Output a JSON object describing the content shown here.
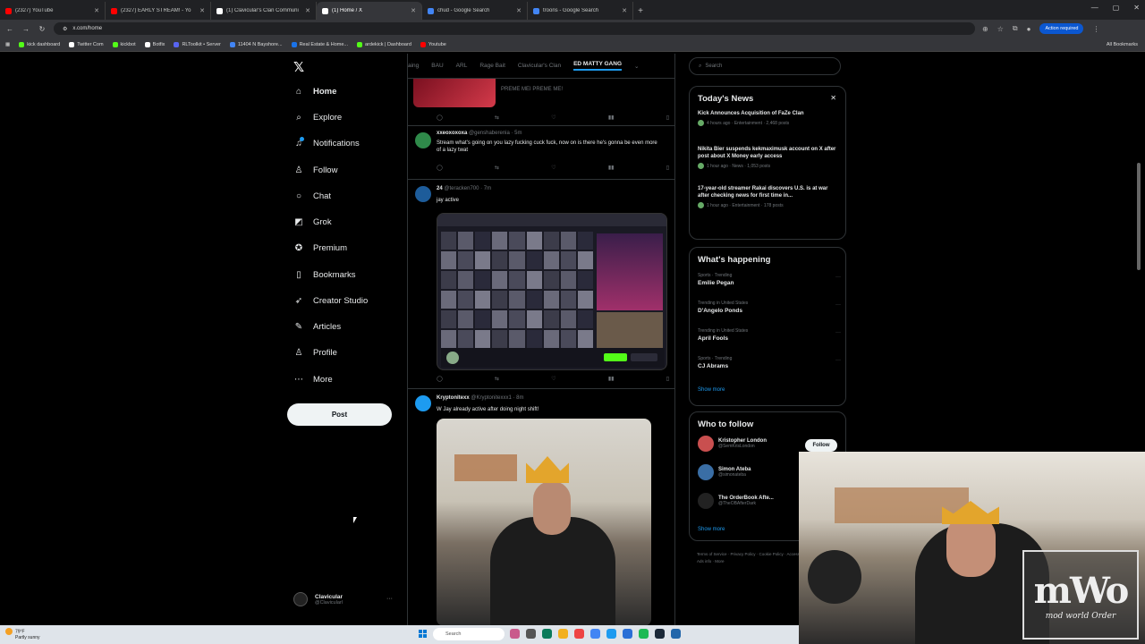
{
  "browser": {
    "tabs": [
      {
        "title": "(2327) YouTube",
        "color": "#ff0000",
        "active": false
      },
      {
        "title": "(2327) EARLY STREAM! - Yo",
        "color": "#ff0000",
        "active": false
      },
      {
        "title": "(1) Clavicular's Clan Communi",
        "color": "#ffffff",
        "active": false
      },
      {
        "title": "(1) Home / X",
        "color": "#ffffff",
        "active": true
      },
      {
        "title": "chud - Google Search",
        "color": "#4285f4",
        "active": false
      },
      {
        "title": "troons - Google Search",
        "color": "#4285f4",
        "active": false
      }
    ],
    "url": "x.com/home",
    "action_required": "Action required",
    "bookmarks": [
      {
        "label": "kick dashboard",
        "color": "#53fc18"
      },
      {
        "label": "Twitter Com",
        "color": "#ffffff"
      },
      {
        "label": "kickbot",
        "color": "#53fc18"
      },
      {
        "label": "Botfix",
        "color": "#ffffff"
      },
      {
        "label": "RLToolkit • Server",
        "color": "#5865f2"
      },
      {
        "label": "11404 N Bayshore...",
        "color": "#4285f4"
      },
      {
        "label": "Real Estate & Home...",
        "color": "#1a73e8"
      },
      {
        "label": "ardekick | Dashboard",
        "color": "#53fc18"
      },
      {
        "label": "Youtube",
        "color": "#ff0000"
      }
    ],
    "all_bookmarks": "All Bookmarks"
  },
  "nav": {
    "items": [
      {
        "label": "Home",
        "icon": "home-icon",
        "glyph": "⌂"
      },
      {
        "label": "Explore",
        "icon": "search-icon",
        "glyph": "⌕"
      },
      {
        "label": "Notifications",
        "icon": "bell-icon",
        "glyph": "♫"
      },
      {
        "label": "Follow",
        "icon": "person-plus-icon",
        "glyph": "♙"
      },
      {
        "label": "Chat",
        "icon": "chat-icon",
        "glyph": "○"
      },
      {
        "label": "Grok",
        "icon": "grok-icon",
        "glyph": "◩"
      },
      {
        "label": "Premium",
        "icon": "premium-icon",
        "glyph": "✪"
      },
      {
        "label": "Bookmarks",
        "icon": "bookmark-icon",
        "glyph": "▯"
      },
      {
        "label": "Creator Studio",
        "icon": "rocket-icon",
        "glyph": "➶"
      },
      {
        "label": "Articles",
        "icon": "article-icon",
        "glyph": "✎"
      },
      {
        "label": "Profile",
        "icon": "profile-icon",
        "glyph": "♙"
      },
      {
        "label": "More",
        "icon": "more-icon",
        "glyph": "⋯"
      }
    ],
    "post_label": "Post",
    "account_name": "Clavicular",
    "account_handle": "@Clavicularl"
  },
  "feed": {
    "topics": [
      "aing",
      "BAU",
      "ARL",
      "Rage Bait",
      "Clavicular's Clan",
      "ED MATTY GANG"
    ],
    "post0": {
      "text": "PREME MEI PREME ME!"
    },
    "post1": {
      "name": "xxeoxoxoxa",
      "meta": "@genshaberenia · 5m",
      "text": "Stream what's going on you lazy fucking cuck fuck, now on is there he's gonna be even more of a lazy twat"
    },
    "post2": {
      "name": "24",
      "meta": "@teracken700 · 7m",
      "text": "jay active"
    },
    "post3": {
      "name": "Kryptonitexx",
      "meta": "@Kryptonitexxx1 · 8m",
      "text": "W Jay already active after doing night shift!"
    }
  },
  "sidebar": {
    "search_placeholder": "Search",
    "news_title": "Today's News",
    "news": [
      {
        "title": "Kick Announces Acquisition of FaZe Clan",
        "meta": "4 hours ago · Entertainment · 2,468 posts"
      },
      {
        "title": "Nikita Bier suspends kekmaximusk account on X after post about X Money early access",
        "meta": "1 hour ago · News · 1,053 posts"
      },
      {
        "title": "17-year-old streamer Rakai discovers U.S. is at war after checking news for first time in...",
        "meta": "1 hour ago · Entertainment · 178 posts"
      }
    ],
    "happening_title": "What's happening",
    "trends": [
      {
        "cat": "Sports · Trending",
        "name": "Emilie Pegan"
      },
      {
        "cat": "Trending in United States",
        "name": "D'Angelo Ponds"
      },
      {
        "cat": "Trending in United States",
        "name": "April Fools"
      },
      {
        "cat": "Sports · Trending",
        "name": "CJ Abrams"
      }
    ],
    "show_more": "Show more",
    "who_title": "Who to follow",
    "who": [
      {
        "name": "Kristopher London",
        "handle": "@SemKrisLondon",
        "color": "#c94f4f"
      },
      {
        "name": "Simon Ateba",
        "handle": "@simonateba",
        "color": "#3a6ea5"
      },
      {
        "name": "The OrderBook Afte...",
        "handle": "@TheOBAfterDark",
        "color": "#222"
      }
    ],
    "follow_label": "Follow",
    "footer": "Terms of Service · Privacy Policy · Cookie Policy · Accessibility · Ads info · More"
  },
  "taskbar": {
    "temp": "79°F",
    "cond": "Partly sunny",
    "search_placeholder": "Search"
  },
  "overlay": {
    "logo_text": "mWo",
    "logo_sub": "mod world Order"
  }
}
